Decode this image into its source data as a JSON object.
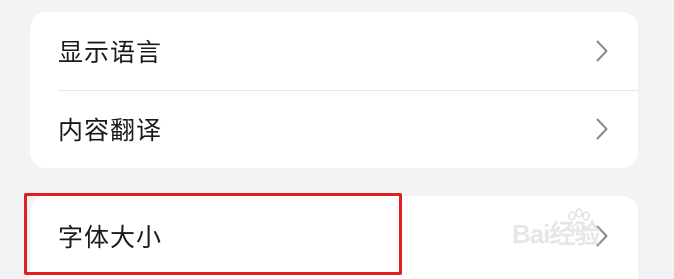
{
  "settings": {
    "rows": [
      {
        "label": "显示语言",
        "chevron": "chevron-right-icon"
      },
      {
        "label": "内容翻译",
        "chevron": "chevron-right-icon"
      },
      {
        "label": "字体大小",
        "chevron": "chevron-right-icon"
      }
    ]
  },
  "annotation": {
    "highlight_color": "#e02020"
  },
  "watermark": {
    "text": "Bai经验"
  }
}
